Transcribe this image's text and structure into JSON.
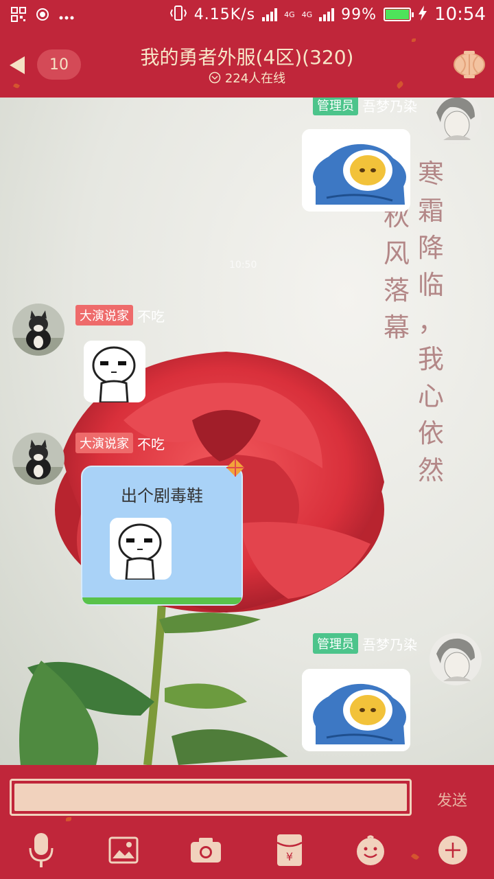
{
  "status_bar": {
    "speed": "4.15K/s",
    "network_1": "4G",
    "network_2": "4G",
    "battery_percent": "99%",
    "battery_level": 0.99,
    "time": "10:54"
  },
  "header": {
    "unread_count": "10",
    "title": "我的勇者外服(4区)(320)",
    "online": "224人在线"
  },
  "chat": {
    "time_divider": "10:50",
    "poem_right": [
      "寒",
      "霜",
      "降",
      "临",
      "，",
      "我",
      "心",
      "依",
      "然"
    ],
    "poem_left": [
      "秋",
      "风",
      "落",
      "幕"
    ],
    "messages": [
      {
        "sender": "吾梦乃染",
        "title": "管理员",
        "type": "sticker",
        "side": "right"
      },
      {
        "sender": "不吃",
        "title": "大演说家",
        "type": "sticker",
        "side": "left"
      },
      {
        "sender": "不吃",
        "title": "大演说家",
        "type": "bubble",
        "side": "left",
        "text": "出个剧毒鞋"
      },
      {
        "sender": "吾梦乃染",
        "title": "管理员",
        "type": "sticker",
        "side": "right"
      }
    ]
  },
  "input": {
    "placeholder": "",
    "send_label": "发送"
  },
  "toolbar": {
    "items": [
      "microphone-icon",
      "image-icon",
      "camera-icon",
      "red-packet-icon",
      "emoji-icon",
      "plus-icon"
    ]
  },
  "colors": {
    "theme_red": "#c0263a",
    "cream": "#f7e6c8",
    "bubble_blue": "#a9d2f7",
    "admin_tag": "#4cc48b",
    "title_tag": "#ee6b6b"
  }
}
